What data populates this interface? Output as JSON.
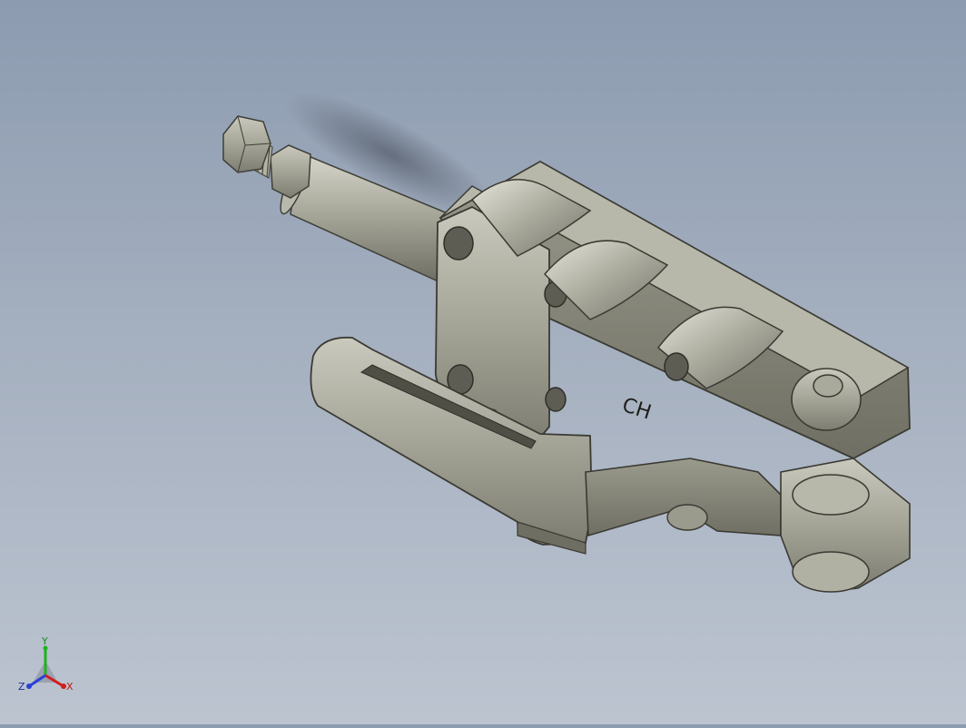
{
  "viewport": {
    "model": {
      "engraving": "CH"
    },
    "triad": {
      "x_label": "X",
      "y_label": "Y",
      "z_label": "Z",
      "x_color": "#d21e1e",
      "y_color": "#1fb21f",
      "z_color": "#2a3fd6"
    }
  }
}
